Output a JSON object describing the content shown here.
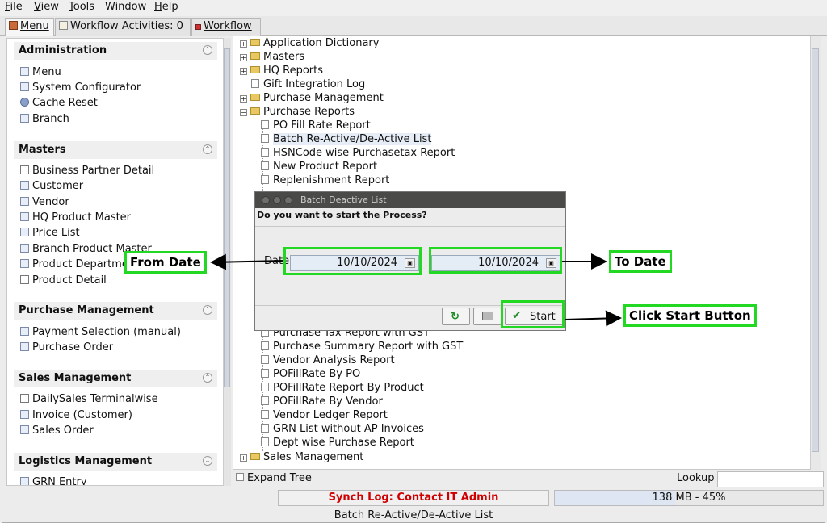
{
  "menubar": [
    {
      "label": "File",
      "accel": "F"
    },
    {
      "label": "View",
      "accel": "V"
    },
    {
      "label": "Tools",
      "accel": "T"
    },
    {
      "label": "Window",
      "accel": ""
    },
    {
      "label": "Help",
      "accel": "H"
    }
  ],
  "tabs": [
    {
      "label": "Menu",
      "icon": "home-icon",
      "active": true
    },
    {
      "label": "Workflow Activities: 0",
      "icon": "list-icon",
      "active": false
    },
    {
      "label": "Workflow",
      "icon": "workflow-icon",
      "active": false
    }
  ],
  "left_panel": {
    "sections": [
      {
        "title": "Administration",
        "items": [
          {
            "label": "Menu",
            "icon": "window-icon"
          },
          {
            "label": "System Configurator",
            "icon": "window-icon"
          },
          {
            "label": "Cache Reset",
            "icon": "gear-icon"
          },
          {
            "label": "Branch",
            "icon": "window-icon"
          }
        ]
      },
      {
        "title": "Masters",
        "items": [
          {
            "label": "Business Partner Detail",
            "icon": "checkbox-icon"
          },
          {
            "label": "Customer",
            "icon": "window-icon"
          },
          {
            "label": "Vendor",
            "icon": "window-icon"
          },
          {
            "label": "HQ Product Master",
            "icon": "window-icon"
          },
          {
            "label": "Price List",
            "icon": "window-icon"
          },
          {
            "label": "Branch Product Master",
            "icon": "window-icon"
          },
          {
            "label": "Product Department",
            "icon": "window-icon"
          },
          {
            "label": "Product Detail",
            "icon": "checkbox-icon"
          }
        ]
      },
      {
        "title": "Purchase Management",
        "items": [
          {
            "label": "Payment Selection (manual)",
            "icon": "window-icon"
          },
          {
            "label": "Purchase Order",
            "icon": "window-icon"
          }
        ]
      },
      {
        "title": "Sales Management",
        "items": [
          {
            "label": "DailySales Terminalwise",
            "icon": "checkbox-icon"
          },
          {
            "label": "Invoice (Customer)",
            "icon": "window-icon"
          },
          {
            "label": "Sales Order",
            "icon": "window-icon"
          }
        ]
      },
      {
        "title": "Logistics Management",
        "items": [
          {
            "label": "GRN Entry",
            "icon": "window-icon"
          }
        ]
      }
    ]
  },
  "tree": {
    "folders_top": [
      {
        "label": "Application Dictionary",
        "type": "folder"
      },
      {
        "label": "Masters",
        "type": "folder"
      },
      {
        "label": "HQ Reports",
        "type": "folder"
      },
      {
        "label": "Gift Integration Log",
        "type": "window"
      },
      {
        "label": "Purchase Management",
        "type": "folder"
      },
      {
        "label": "Purchase Reports",
        "type": "folder-open"
      }
    ],
    "reports_top": [
      {
        "label": "PO Fill Rate Report"
      },
      {
        "label": "Batch Re-Active/De-Active List",
        "selected": true
      },
      {
        "label": "HSNCode wise Purchasetax Report"
      },
      {
        "label": "New Product Report"
      },
      {
        "label": "Replenishment Report"
      }
    ],
    "reports_bottom": [
      {
        "label": "Purchase Tax Report with GST"
      },
      {
        "label": "Purchase Summary Report with GST"
      },
      {
        "label": "Vendor Analysis Report"
      },
      {
        "label": "POFillRate By PO"
      },
      {
        "label": "POFillRate Report By Product"
      },
      {
        "label": "POFillRate By Vendor"
      },
      {
        "label": "Vendor Ledger Report"
      },
      {
        "label": "GRN List without AP Invoices"
      },
      {
        "label": "Dept wise Purchase Report"
      }
    ],
    "folders_bottom": [
      {
        "label": "Sales Management"
      }
    ],
    "expand_tree_label": "Expand Tree",
    "lookup_label": "Lookup"
  },
  "dialog": {
    "title": "Batch Deactive List",
    "message": "Do you want to start the Process?",
    "date_label": "Date",
    "from_date": "10/10/2024",
    "to_date": "10/10/2024",
    "start_label": "Start"
  },
  "annotations": {
    "from_date": "From Date",
    "to_date": "To Date",
    "start": "Click Start Button",
    "highlight_color": "#22d822"
  },
  "status": {
    "synch_log": "Synch Log: Contact IT Admin",
    "memory": "138 MB - 45%",
    "memory_percent": 45,
    "status_text": "Batch Re-Active/De-Active List"
  }
}
